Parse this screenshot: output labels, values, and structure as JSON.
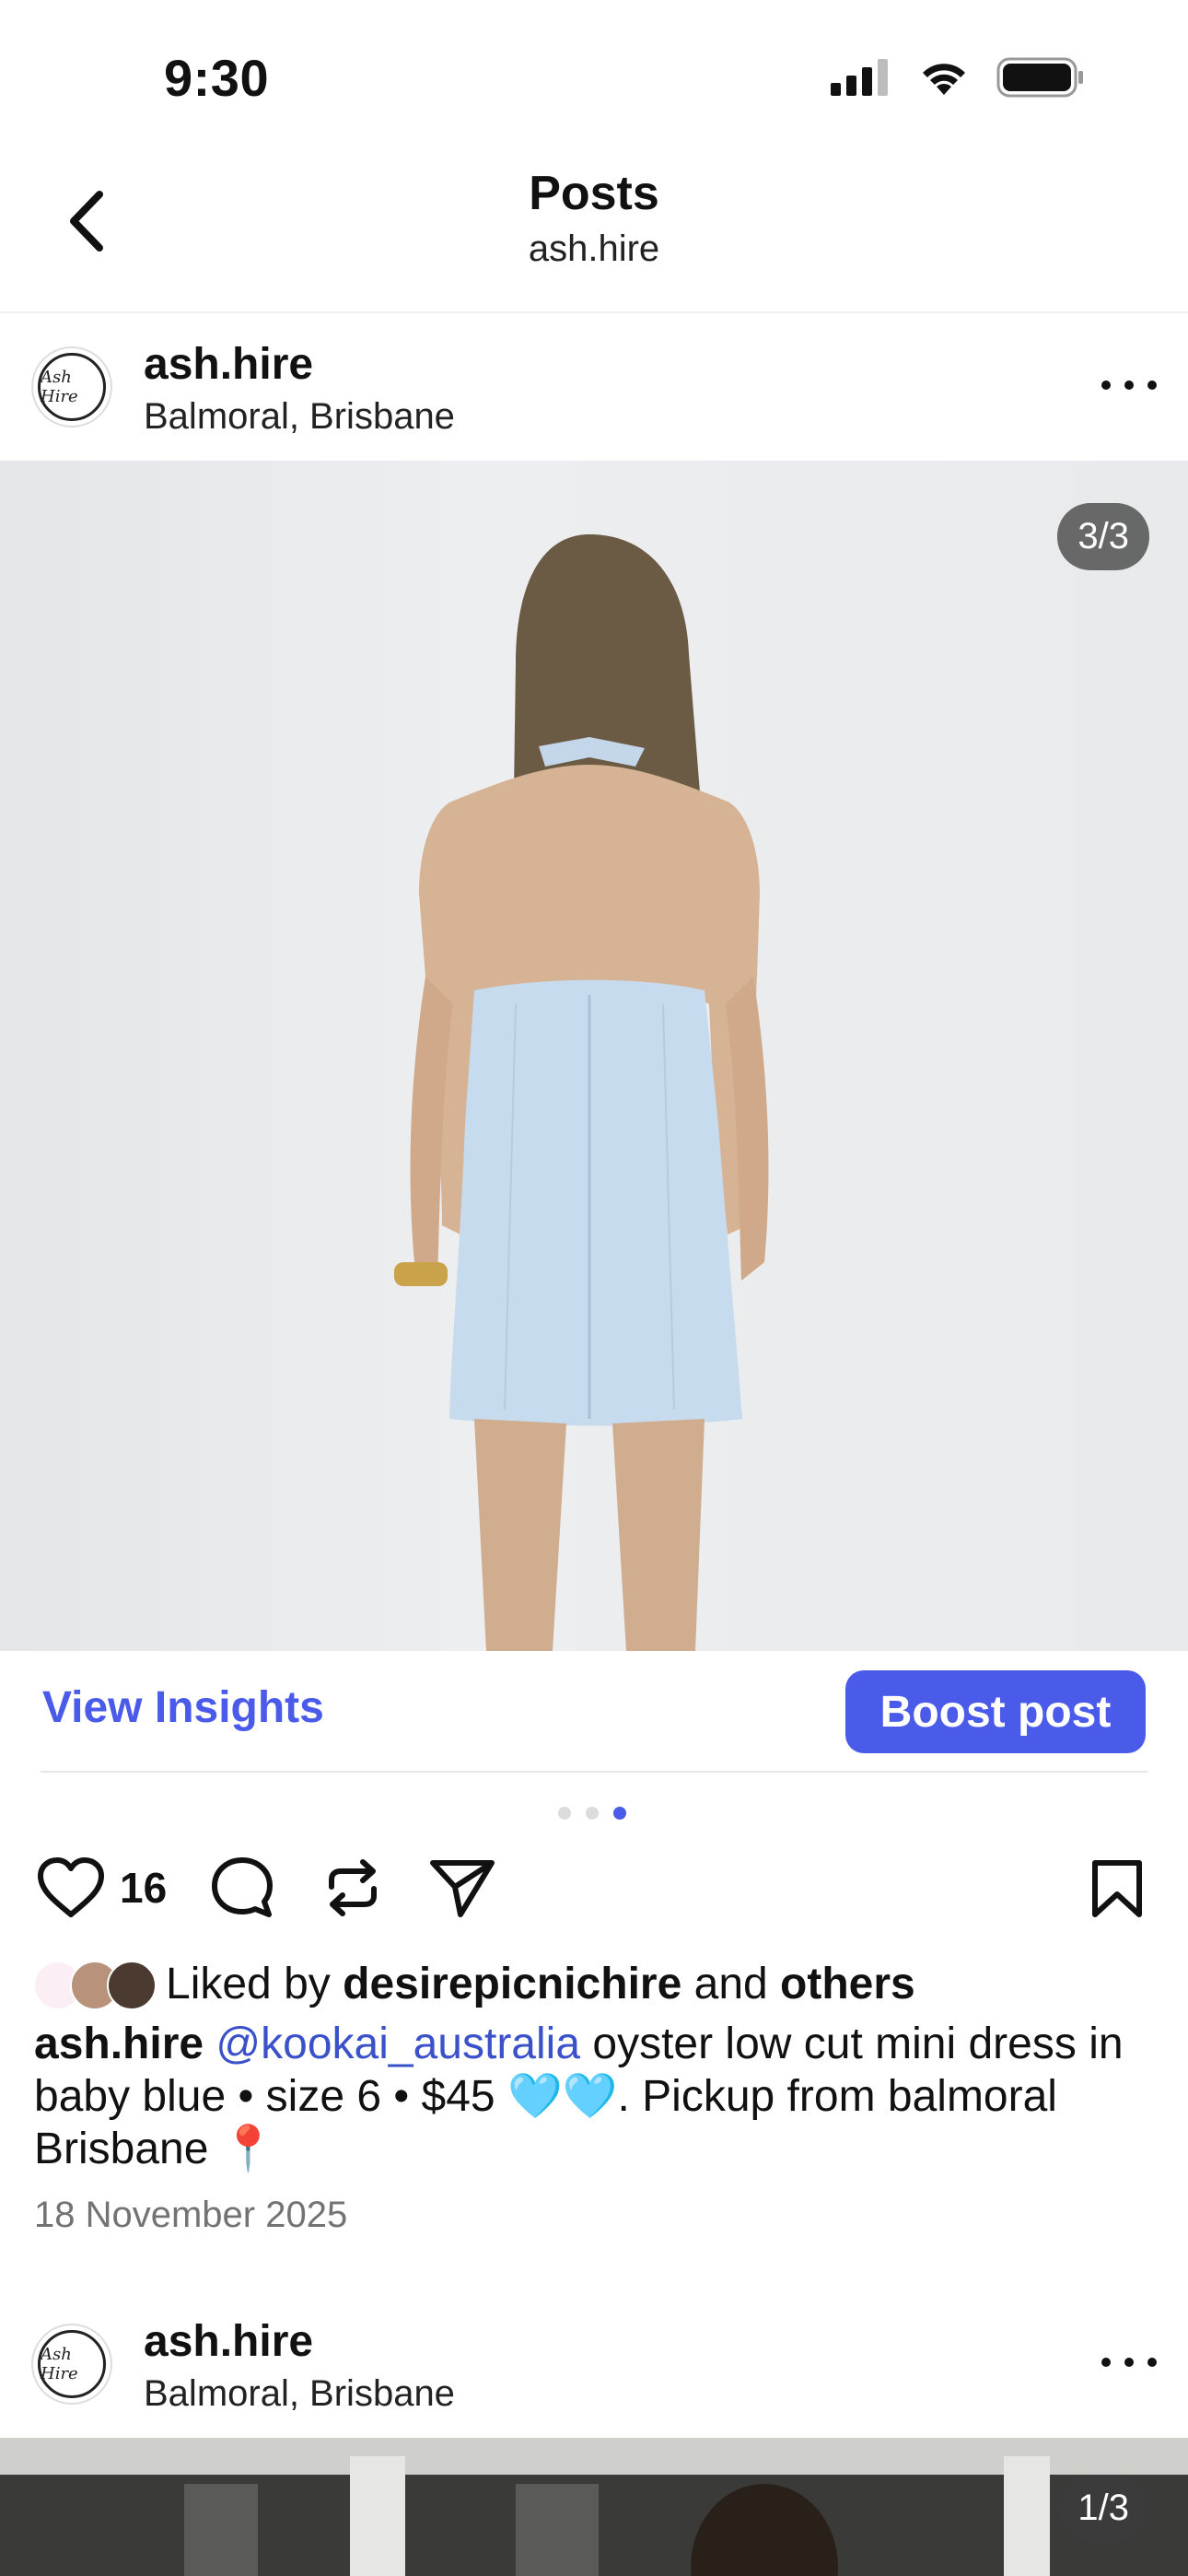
{
  "status_bar": {
    "time": "9:30",
    "signal_icon": "cellular-signal-icon",
    "wifi_icon": "wifi-icon",
    "battery_icon": "battery-icon"
  },
  "header": {
    "title": "Posts",
    "subtitle": "ash.hire",
    "back_icon": "chevron-left-icon"
  },
  "post": {
    "username": "ash.hire",
    "location": "Balmoral, Brisbane",
    "avatar_text": "Ash Hire",
    "image_counter": "3/3",
    "view_insights_label": "View Insights",
    "boost_label": "Boost post",
    "carousel_active_index": 3,
    "carousel_total": 3,
    "like_count": "16",
    "liked_by_prefix": "Liked by ",
    "liked_by_user": "desirepicnichire",
    "liked_by_and": " and ",
    "liked_by_others": "others",
    "caption_user": "ash.hire",
    "caption_mention": "@kookai_australia",
    "caption_text": " oyster low cut mini dress in baby blue • size 6 • $45 🩵🩵. Pickup from balmoral Brisbane 📍",
    "date": "18 November 2025",
    "accent_color": "#4a5bea"
  },
  "next_post": {
    "username": "ash.hire",
    "location": "Balmoral, Brisbane",
    "avatar_text": "Ash Hire",
    "image_counter": "1/3"
  }
}
